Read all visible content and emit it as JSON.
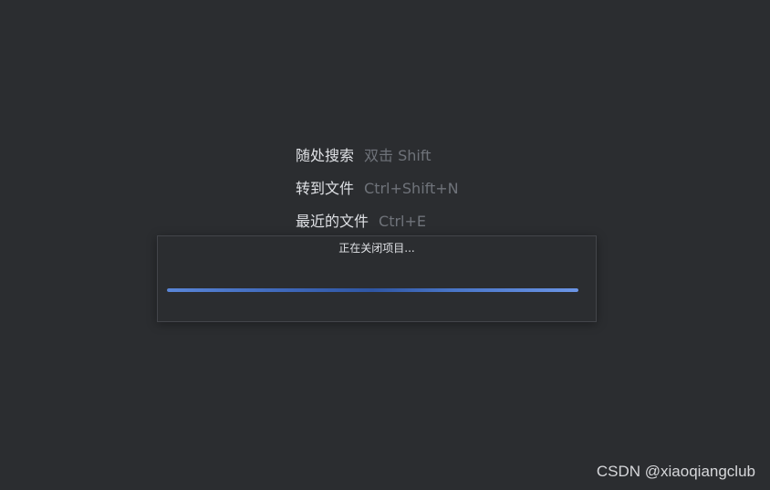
{
  "hints": [
    {
      "label": "随处搜索",
      "shortcut": "双击 Shift"
    },
    {
      "label": "转到文件",
      "shortcut": "Ctrl+Shift+N"
    },
    {
      "label": "最近的文件",
      "shortcut": "Ctrl+E"
    }
  ],
  "progress_dialog": {
    "title": "正在关闭项目...",
    "progress_fraction": 1.0,
    "accent_color": "#4a76c8"
  },
  "watermark": "CSDN @xiaoqiangclub",
  "colors": {
    "background": "#2b2d30",
    "text_primary": "#dfe1e5",
    "text_secondary": "#6f737a"
  }
}
